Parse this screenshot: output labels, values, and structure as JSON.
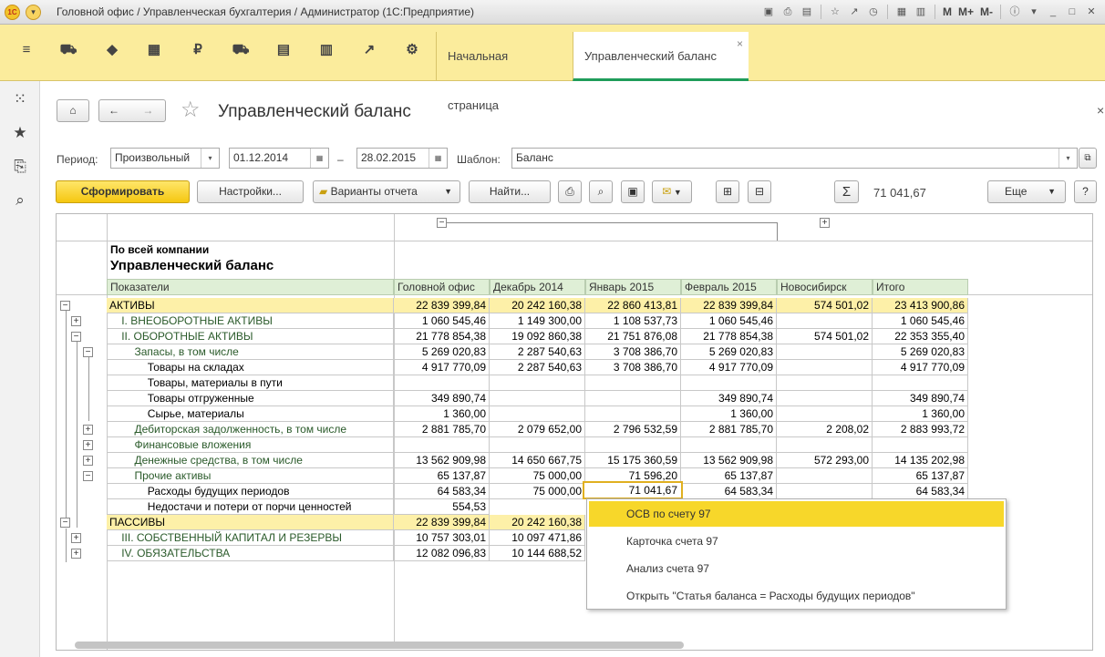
{
  "window": {
    "title": "Головной офис / Управленческая бухгалтерия / Администратор (1С:Предприятие)",
    "logo_text": "1С",
    "toolbar_text": [
      "M",
      "M+",
      "M-"
    ]
  },
  "tabs": [
    {
      "label": "Начальная страница"
    },
    {
      "label": "Управленческий баланс"
    }
  ],
  "tab_close": "×",
  "form": {
    "title": "Управленческий баланс",
    "close": "×",
    "period_label": "Период:",
    "period_type": "Произвольный",
    "date_from": "01.12.2014",
    "dash": "–",
    "date_to": "28.02.2015",
    "template_label": "Шаблон:",
    "template_value": "Баланс"
  },
  "toolbar": {
    "generate": "Сформировать",
    "settings": "Настройки...",
    "variants": "Варианты отчета",
    "find": "Найти...",
    "sum_symbol": "Σ",
    "sum_value": "71 041,67",
    "more": "Еще",
    "help": "?"
  },
  "report": {
    "company": "По всей компании",
    "title": "Управленческий баланс",
    "indicators_header": "Показатели",
    "columns": [
      "Головной офис",
      "Декабрь 2014",
      "Январь 2015",
      "Февраль 2015",
      "Новосибирск",
      "Итого"
    ],
    "rows": [
      {
        "name": "АКТИВЫ",
        "values": [
          "22 839 399,84",
          "20 242 160,38",
          "22 860 413,81",
          "22 839 399,84",
          "574 501,02",
          "23 413 900,86"
        ]
      },
      {
        "name": "I. ВНЕОБОРОТНЫЕ АКТИВЫ",
        "values": [
          "1 060 545,46",
          "1 149 300,00",
          "1 108 537,73",
          "1 060 545,46",
          "",
          "1 060 545,46"
        ]
      },
      {
        "name": "II. ОБОРОТНЫЕ АКТИВЫ",
        "values": [
          "21 778 854,38",
          "19 092 860,38",
          "21 751 876,08",
          "21 778 854,38",
          "574 501,02",
          "22 353 355,40"
        ]
      },
      {
        "name": "Запасы, в том числе",
        "values": [
          "5 269 020,83",
          "2 287 540,63",
          "3 708 386,70",
          "5 269 020,83",
          "",
          "5 269 020,83"
        ]
      },
      {
        "name": "Товары на складах",
        "values": [
          "4 917 770,09",
          "2 287 540,63",
          "3 708 386,70",
          "4 917 770,09",
          "",
          "4 917 770,09"
        ]
      },
      {
        "name": "Товары, материалы в пути",
        "values": [
          "",
          "",
          "",
          "",
          "",
          ""
        ]
      },
      {
        "name": "Товары отгруженные",
        "values": [
          "349 890,74",
          "",
          "",
          "349 890,74",
          "",
          "349 890,74"
        ]
      },
      {
        "name": "Сырье, материалы",
        "values": [
          "1 360,00",
          "",
          "",
          "1 360,00",
          "",
          "1 360,00"
        ]
      },
      {
        "name": "Дебиторская задолженность, в том числе",
        "values": [
          "2 881 785,70",
          "2 079 652,00",
          "2 796 532,59",
          "2 881 785,70",
          "2 208,02",
          "2 883 993,72"
        ]
      },
      {
        "name": "Финансовые вложения",
        "values": [
          "",
          "",
          "",
          "",
          "",
          ""
        ]
      },
      {
        "name": "Денежные средства, в том числе",
        "values": [
          "13 562 909,98",
          "14 650 667,75",
          "15 175 360,59",
          "13 562 909,98",
          "572 293,00",
          "14 135 202,98"
        ]
      },
      {
        "name": "Прочие активы",
        "values": [
          "65 137,87",
          "75 000,00",
          "71 596,20",
          "65 137,87",
          "",
          "65 137,87"
        ]
      },
      {
        "name": "Расходы будущих периодов",
        "values": [
          "64 583,34",
          "75 000,00",
          "71 041,67",
          "64 583,34",
          "",
          "64 583,34"
        ]
      },
      {
        "name": "Недостачи и потери от порчи ценностей",
        "values": [
          "554,53",
          "",
          "",
          "",
          "",
          ""
        ]
      },
      {
        "name": "ПАССИВЫ",
        "values": [
          "22 839 399,84",
          "20 242 160,38",
          "",
          "",
          "",
          ""
        ]
      },
      {
        "name": "III. СОБСТВЕННЫЙ КАПИТАЛ И РЕЗЕРВЫ",
        "values": [
          "10 757 303,01",
          "10 097 471,86",
          "",
          "",
          "",
          ""
        ]
      },
      {
        "name": "IV. ОБЯЗАТЕЛЬСТВА",
        "values": [
          "12 082 096,83",
          "10 144 688,52",
          "",
          "",
          "",
          ""
        ]
      }
    ]
  },
  "context_menu": [
    "ОСВ по счету 97",
    "Карточка счета 97",
    "Анализ счета 97",
    "Открыть \"Статья баланса = Расходы будущих периодов\""
  ],
  "colors": {
    "accent_yellow": "#f5c710",
    "highlight_row": "#fdf0a8",
    "header_green": "#dfefd6",
    "active_tab_underline": "#1f9c5a"
  }
}
